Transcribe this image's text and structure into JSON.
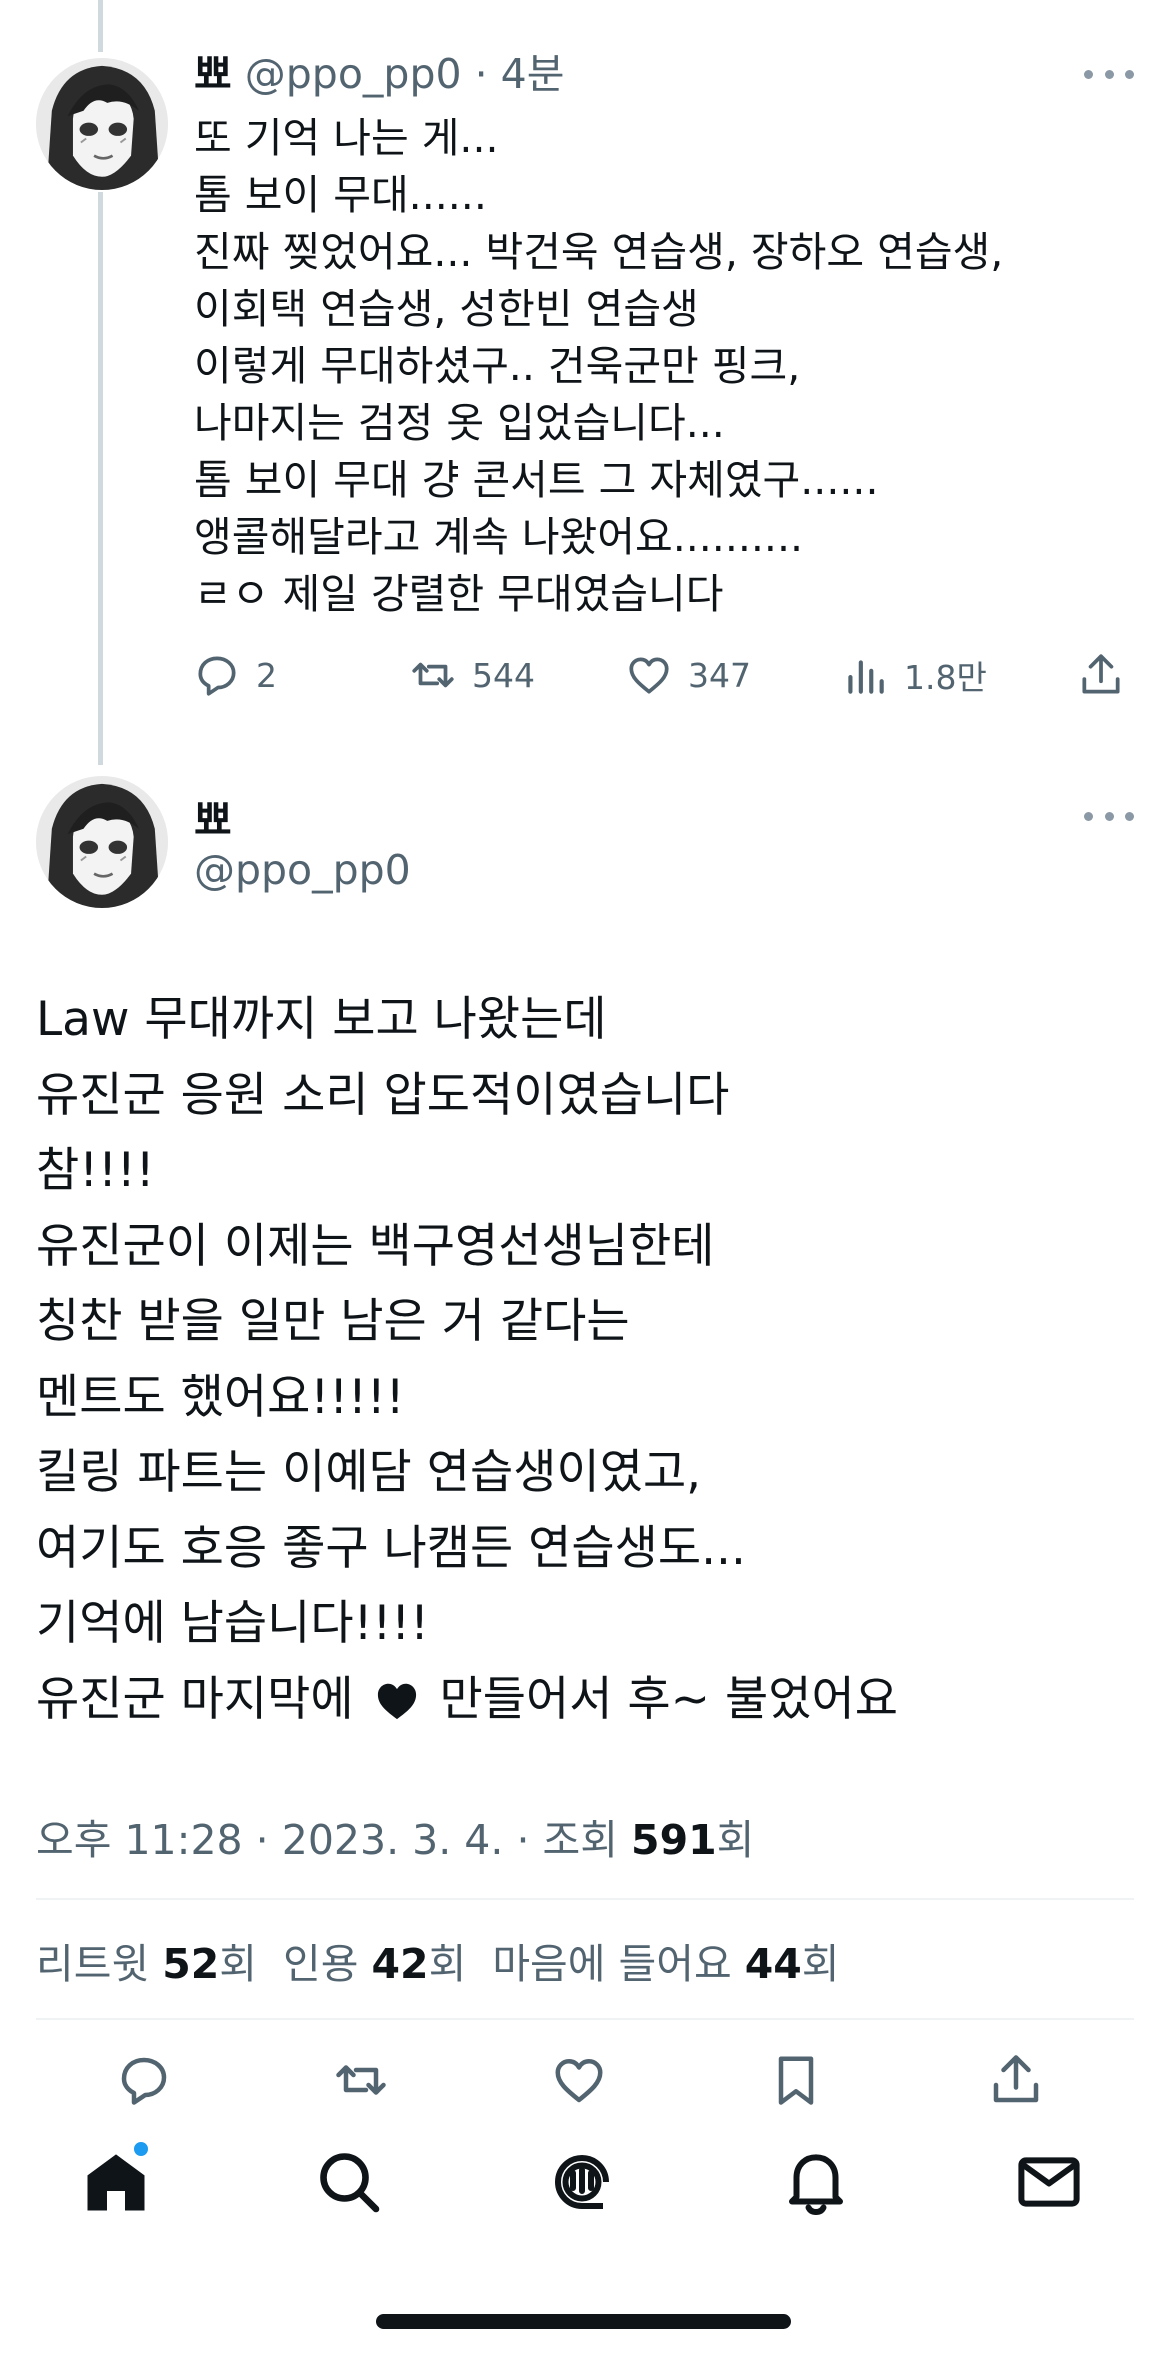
{
  "reply": {
    "name": "뾰",
    "handle": "@ppo_pp0",
    "separator": " · ",
    "time": "4분",
    "lines": [
      "또 기억 나는 게...",
      "톰 보이 무대......",
      "진짜 찢었어요... 박건욱 연습생, 장하오 연습생,",
      "이회택 연습생, 성한빈 연습생",
      "이렇게 무대하셨구.. 건욱군만 핑크,",
      "나마지는 검정 옷 입었습니다...",
      "톰 보이 무대 걍 콘서트 그 자체였구......",
      "앵콜해달라고 계속 나왔어요..........",
      "ㄹㅇ 제일 강렬한 무대였습니다"
    ],
    "actions": {
      "replies": "2",
      "retweets": "544",
      "likes": "347",
      "views": "1.8만"
    }
  },
  "tweet": {
    "name": "뾰",
    "handle": "@ppo_pp0",
    "lines": [
      "Law 무대까지 보고 나왔는데",
      "유진군 응원 소리 압도적이였습니다",
      "참!!!!",
      "유진군이 이제는 백구영선생님한테",
      "칭찬 받을 일만 남은 거 같다는",
      "멘트도 했어요!!!!!",
      "킬링 파트는 이예담 연습생이였고,",
      "여기도 호응 좋구 나캠든 연습생도...",
      "기억에 남습니다!!!!"
    ],
    "last_line_before": "유진군 마지막에",
    "last_line_after": "만들어서 후~ 불었어요",
    "meta": {
      "time": "오후 11:28",
      "date": "2023. 3. 4.",
      "views_label": "조회",
      "views_count": "591",
      "views_unit": "회",
      "sep": " · "
    },
    "stats": {
      "retweets_label": "리트윗",
      "retweets": "52",
      "quotes_label": "인용",
      "quotes": "42",
      "likes_label": "마음에 들어요",
      "likes": "44",
      "unit": "회"
    }
  },
  "colors": {
    "text": "#0f1419",
    "muted": "#536471",
    "accent": "#1d9bf0",
    "divider": "#eff3f4"
  },
  "tabbar": {
    "tabs": [
      "home-icon",
      "search-icon",
      "spaces-icon",
      "notifications-icon",
      "messages-icon"
    ],
    "home_notification": true
  }
}
